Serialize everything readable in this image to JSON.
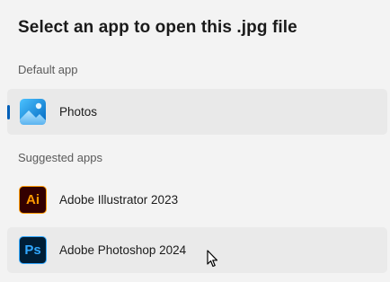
{
  "dialog": {
    "title": "Select an app to open this .jpg file"
  },
  "default_section": {
    "label": "Default app",
    "apps": [
      {
        "name": "Photos",
        "icon": "photos-icon",
        "selected": true
      }
    ]
  },
  "suggested_section": {
    "label": "Suggested apps",
    "apps": [
      {
        "name": "Adobe Illustrator 2023",
        "icon": "adobe-illustrator-icon",
        "icon_text": "Ai"
      },
      {
        "name": "Adobe Photoshop 2024",
        "icon": "adobe-photoshop-icon",
        "icon_text": "Ps",
        "hovered": true
      }
    ]
  },
  "colors": {
    "accent": "#005fb8",
    "illustrator_orange": "#ff9a00",
    "photoshop_blue": "#31a8ff"
  }
}
